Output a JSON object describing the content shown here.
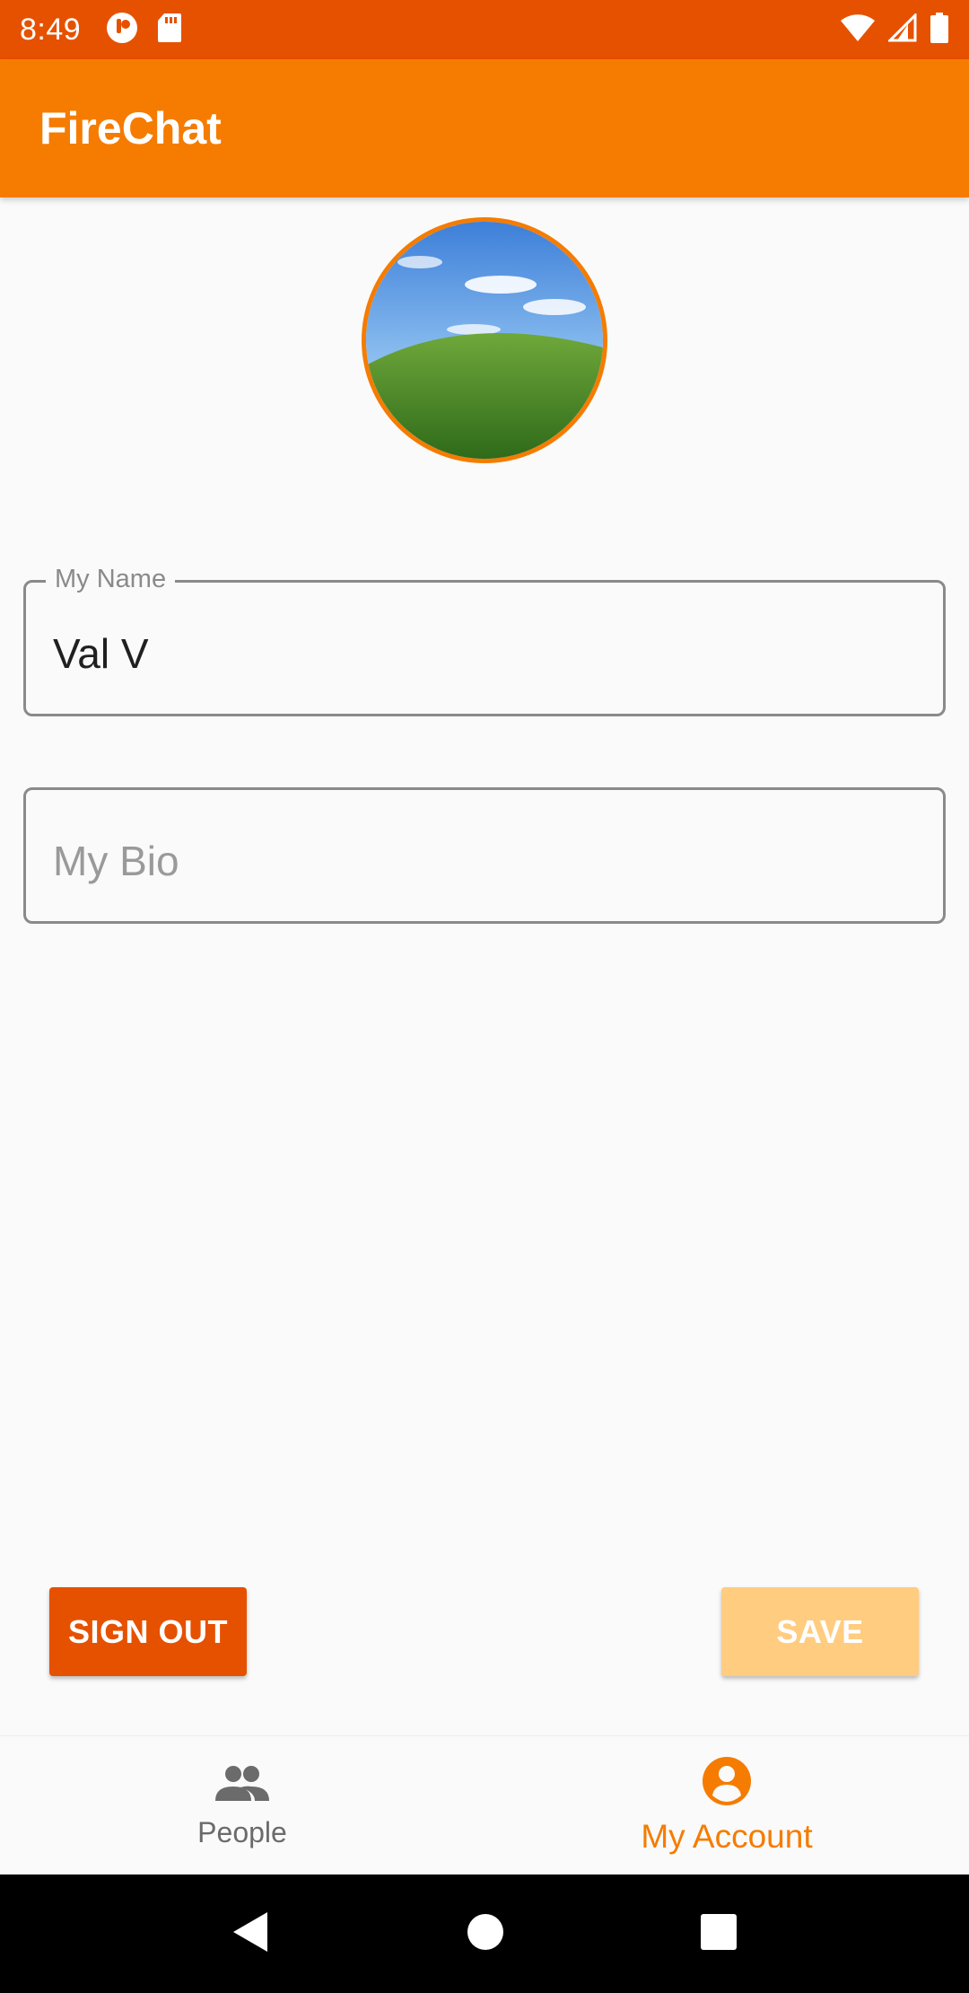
{
  "status_bar": {
    "time": "8:49"
  },
  "app_bar": {
    "title": "FireChat"
  },
  "profile": {
    "name_label": "My Name",
    "name_value": "Val V",
    "bio_placeholder": "My Bio"
  },
  "actions": {
    "sign_out_label": "SIGN OUT",
    "save_label": "SAVE"
  },
  "bottom_nav": {
    "items": [
      {
        "label": "People",
        "icon": "people-icon",
        "active": false
      },
      {
        "label": "My Account",
        "icon": "account-circle-icon",
        "active": true
      }
    ]
  },
  "colors": {
    "status_bar": "#e65100",
    "app_bar": "#f57c00",
    "accent": "#f57c00",
    "sign_out": "#e65100",
    "save_disabled": "#ffcc80"
  }
}
